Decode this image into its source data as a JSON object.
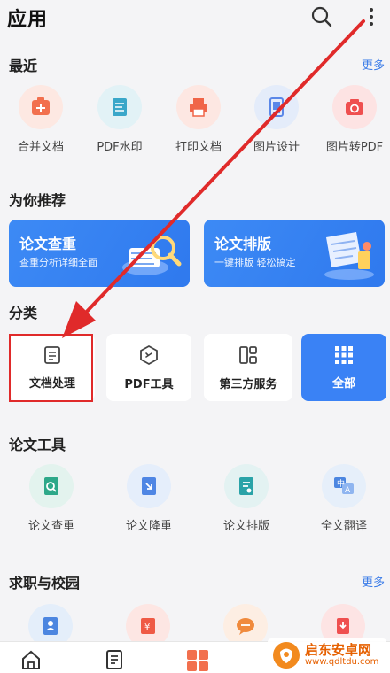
{
  "header": {
    "title": "应用"
  },
  "recent": {
    "title": "最近",
    "more": "更多",
    "items": [
      {
        "label": "合并文档",
        "icon": "merge-doc-icon",
        "bg": "#fde8e2",
        "color": "#f2704e"
      },
      {
        "label": "PDF水印",
        "icon": "pdf-watermark-icon",
        "bg": "#e2f2f6",
        "color": "#3aa7c9"
      },
      {
        "label": "打印文档",
        "icon": "printer-icon",
        "bg": "#fde7e2",
        "color": "#f06548"
      },
      {
        "label": "图片设计",
        "icon": "image-design-icon",
        "bg": "#e4ecfa",
        "color": "#5a87e8"
      },
      {
        "label": "图片转PDF",
        "icon": "image-to-pdf-icon",
        "bg": "#fde3e3",
        "color": "#ef4f4f"
      }
    ]
  },
  "recommend": {
    "title": "为你推荐",
    "banners": [
      {
        "title": "论文查重",
        "subtitle": "查重分析详细全面"
      },
      {
        "title": "论文排版",
        "subtitle": "一键排版 轻松搞定"
      }
    ]
  },
  "categories": {
    "title": "分类",
    "items": [
      {
        "label": "文档处理",
        "icon": "document-icon"
      },
      {
        "label": "PDF工具",
        "icon": "pdf-tool-icon"
      },
      {
        "label": "第三方服务",
        "icon": "third-party-icon"
      },
      {
        "label": "全部",
        "icon": "grid-icon"
      }
    ]
  },
  "paper_tools": {
    "title": "论文工具",
    "items": [
      {
        "label": "论文查重",
        "icon": "paper-check-icon",
        "bg": "#e3f3ee",
        "color": "#2da889"
      },
      {
        "label": "论文降重",
        "icon": "paper-reduce-icon",
        "bg": "#e5eefb",
        "color": "#4f86e4"
      },
      {
        "label": "论文排版",
        "icon": "paper-layout-icon",
        "bg": "#e3f2f2",
        "color": "#2aa3a8"
      },
      {
        "label": "全文翻译",
        "icon": "translate-icon",
        "bg": "#e6effa",
        "color": "#4c86e0"
      }
    ]
  },
  "campus": {
    "title": "求职与校园",
    "more": "更多",
    "items": [
      {
        "icon": "resume-icon",
        "bg": "#e4eefa",
        "color": "#4c86e0"
      },
      {
        "icon": "ticket-icon",
        "bg": "#fde6e3",
        "color": "#ef5a45"
      },
      {
        "icon": "chat-bubble-icon",
        "bg": "#fdeee3",
        "color": "#f08a3c"
      },
      {
        "icon": "badge-icon",
        "bg": "#fde4e4",
        "color": "#ef4f4f"
      }
    ]
  },
  "watermark": {
    "main": "启东安卓网",
    "sub": "www.qdltdu.com"
  }
}
